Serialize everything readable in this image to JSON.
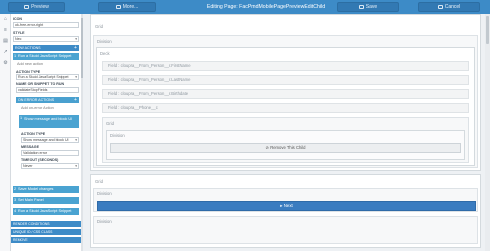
{
  "window": {
    "title": "Editing Page: FacPmdMobilePagePreviewEditChild"
  },
  "toolbar": {
    "preview_label": "Preview",
    "more_label": "More...",
    "save_label": "Save",
    "cancel_label": "Cancel"
  },
  "panel": {
    "icon_label": "ICON",
    "icon_value": "ok-free-error-right",
    "style_label": "STYLE",
    "style_value": "Nec",
    "row_actions_header": "ROW ACTIONS",
    "row_actions_index": "1",
    "row_action_title": "Run a Skuid JavaScript Snippet",
    "add_action_label": "Add new action",
    "action_type_label": "ACTION TYPE",
    "action_type_value": "Run a Skuid JavaScript Snippet",
    "snippet_label": "NAME OR SNIPPET TO RUN",
    "snippet_value": "validateStopFields",
    "on_error_header": "ON ERROR ACTIONS",
    "on_error_add_label": "Add on-error Action",
    "error_item_index": "1",
    "error_item_title": "Show message and block UI",
    "error_action_type_label": "ACTION TYPE",
    "error_action_type_value": "Show message and block UI",
    "message_label": "MESSAGE",
    "message_value": "Validation error",
    "timeout_label": "TIMEOUT (SECONDS)",
    "timeout_value": "Never",
    "step2_index": "2",
    "step2_title": "Save Model changes",
    "step3_index": "3",
    "step3_title": "Set Main Panel",
    "step4_index": "4",
    "step4_title": "Run a Skuid JavaScript Snippet",
    "render_conditions": "RENDER CONDITIONS",
    "unique_id": "UNIQUE ID / CSS CLASS",
    "remove": "REMOVE"
  },
  "canvas": {
    "grid1": "Grid",
    "division1": "Division",
    "deck": "Deck",
    "field_firstname": "Field : cloupra__From_Person__r.FirstName",
    "field_lastname": "Field : cloupra__From_Person__r.LastName",
    "field_birthdate": "Field : cloupra__From_Person__r.Birthdate",
    "field_phone": "Field : cloupra__Phone__c",
    "inner_grid": "Grid",
    "inner_division": "Division",
    "remove_child_button": "Remove This Child",
    "grid2": "Grid",
    "division2": "Division",
    "next_button": "Next",
    "division3": "Division"
  }
}
